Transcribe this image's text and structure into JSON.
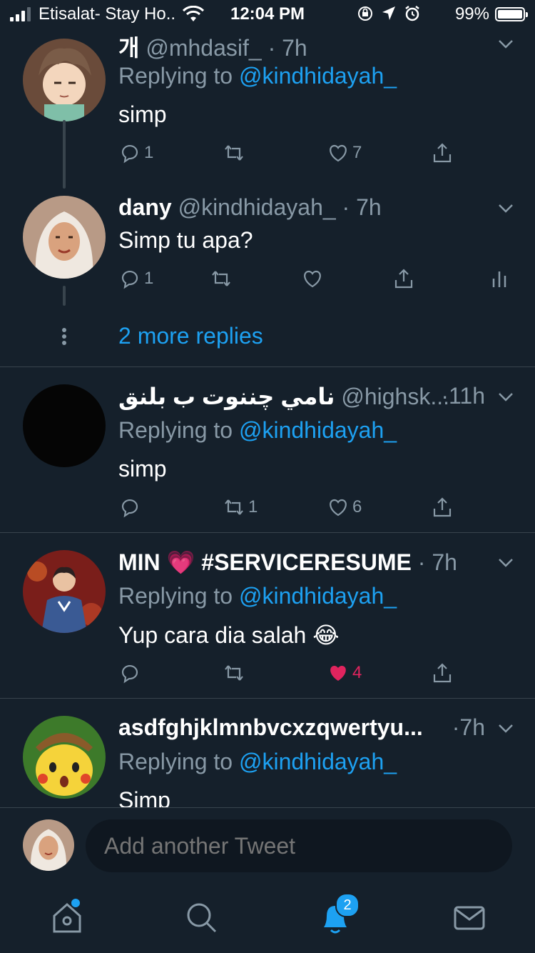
{
  "status": {
    "carrier": "Etisalat- Stay Ho..",
    "time": "12:04 PM",
    "battery": "99%"
  },
  "tweets": [
    {
      "name": "개",
      "handle": "@mhdasif_",
      "time": "7h",
      "reply_prefix": "Replying to ",
      "reply_to": "@kindhidayah_",
      "text": "simp",
      "replies": "1",
      "retweets": "",
      "likes": "7",
      "avatar": "anime-character-avatar"
    },
    {
      "name": "dany",
      "handle": "@kindhidayah_",
      "time": "7h",
      "text": "Simp tu apa?",
      "replies": "1",
      "retweets": "",
      "likes": "",
      "avatar": "hijab-woman-avatar"
    },
    {
      "name": "نامي چننوت ب بلنق",
      "handle": "@highsk...",
      "time": "11h",
      "reply_prefix": "Replying to ",
      "reply_to": "@kindhidayah_",
      "text": "simp",
      "replies": "",
      "retweets": "1",
      "likes": "6",
      "avatar": "black-avatar"
    },
    {
      "name": "MIN 💗 #SERVICERESUME",
      "handle": "",
      "time": "7h",
      "reply_prefix": "Replying to ",
      "reply_to": "@kindhidayah_",
      "text": "Yup cara dia salah 😂",
      "replies": "",
      "retweets": "",
      "likes": "4",
      "liked": true,
      "avatar": "man-in-suit-avatar"
    },
    {
      "name": "asdfghjklmnbvcxzqwertyu...",
      "handle": "",
      "time": "7h",
      "reply_prefix": "Replying to ",
      "reply_to": "@kindhidayah_",
      "text": "Simp",
      "avatar": "surprised-pikachu-avatar"
    }
  ],
  "more_replies": "2 more replies",
  "compose": {
    "placeholder": "Add another Tweet"
  },
  "tabbar": {
    "notifications_badge": "2"
  },
  "colors": {
    "background": "#15202b",
    "accent": "#1da1f2",
    "muted": "#8899a6",
    "like": "#e0245e",
    "divider": "#38444d"
  }
}
